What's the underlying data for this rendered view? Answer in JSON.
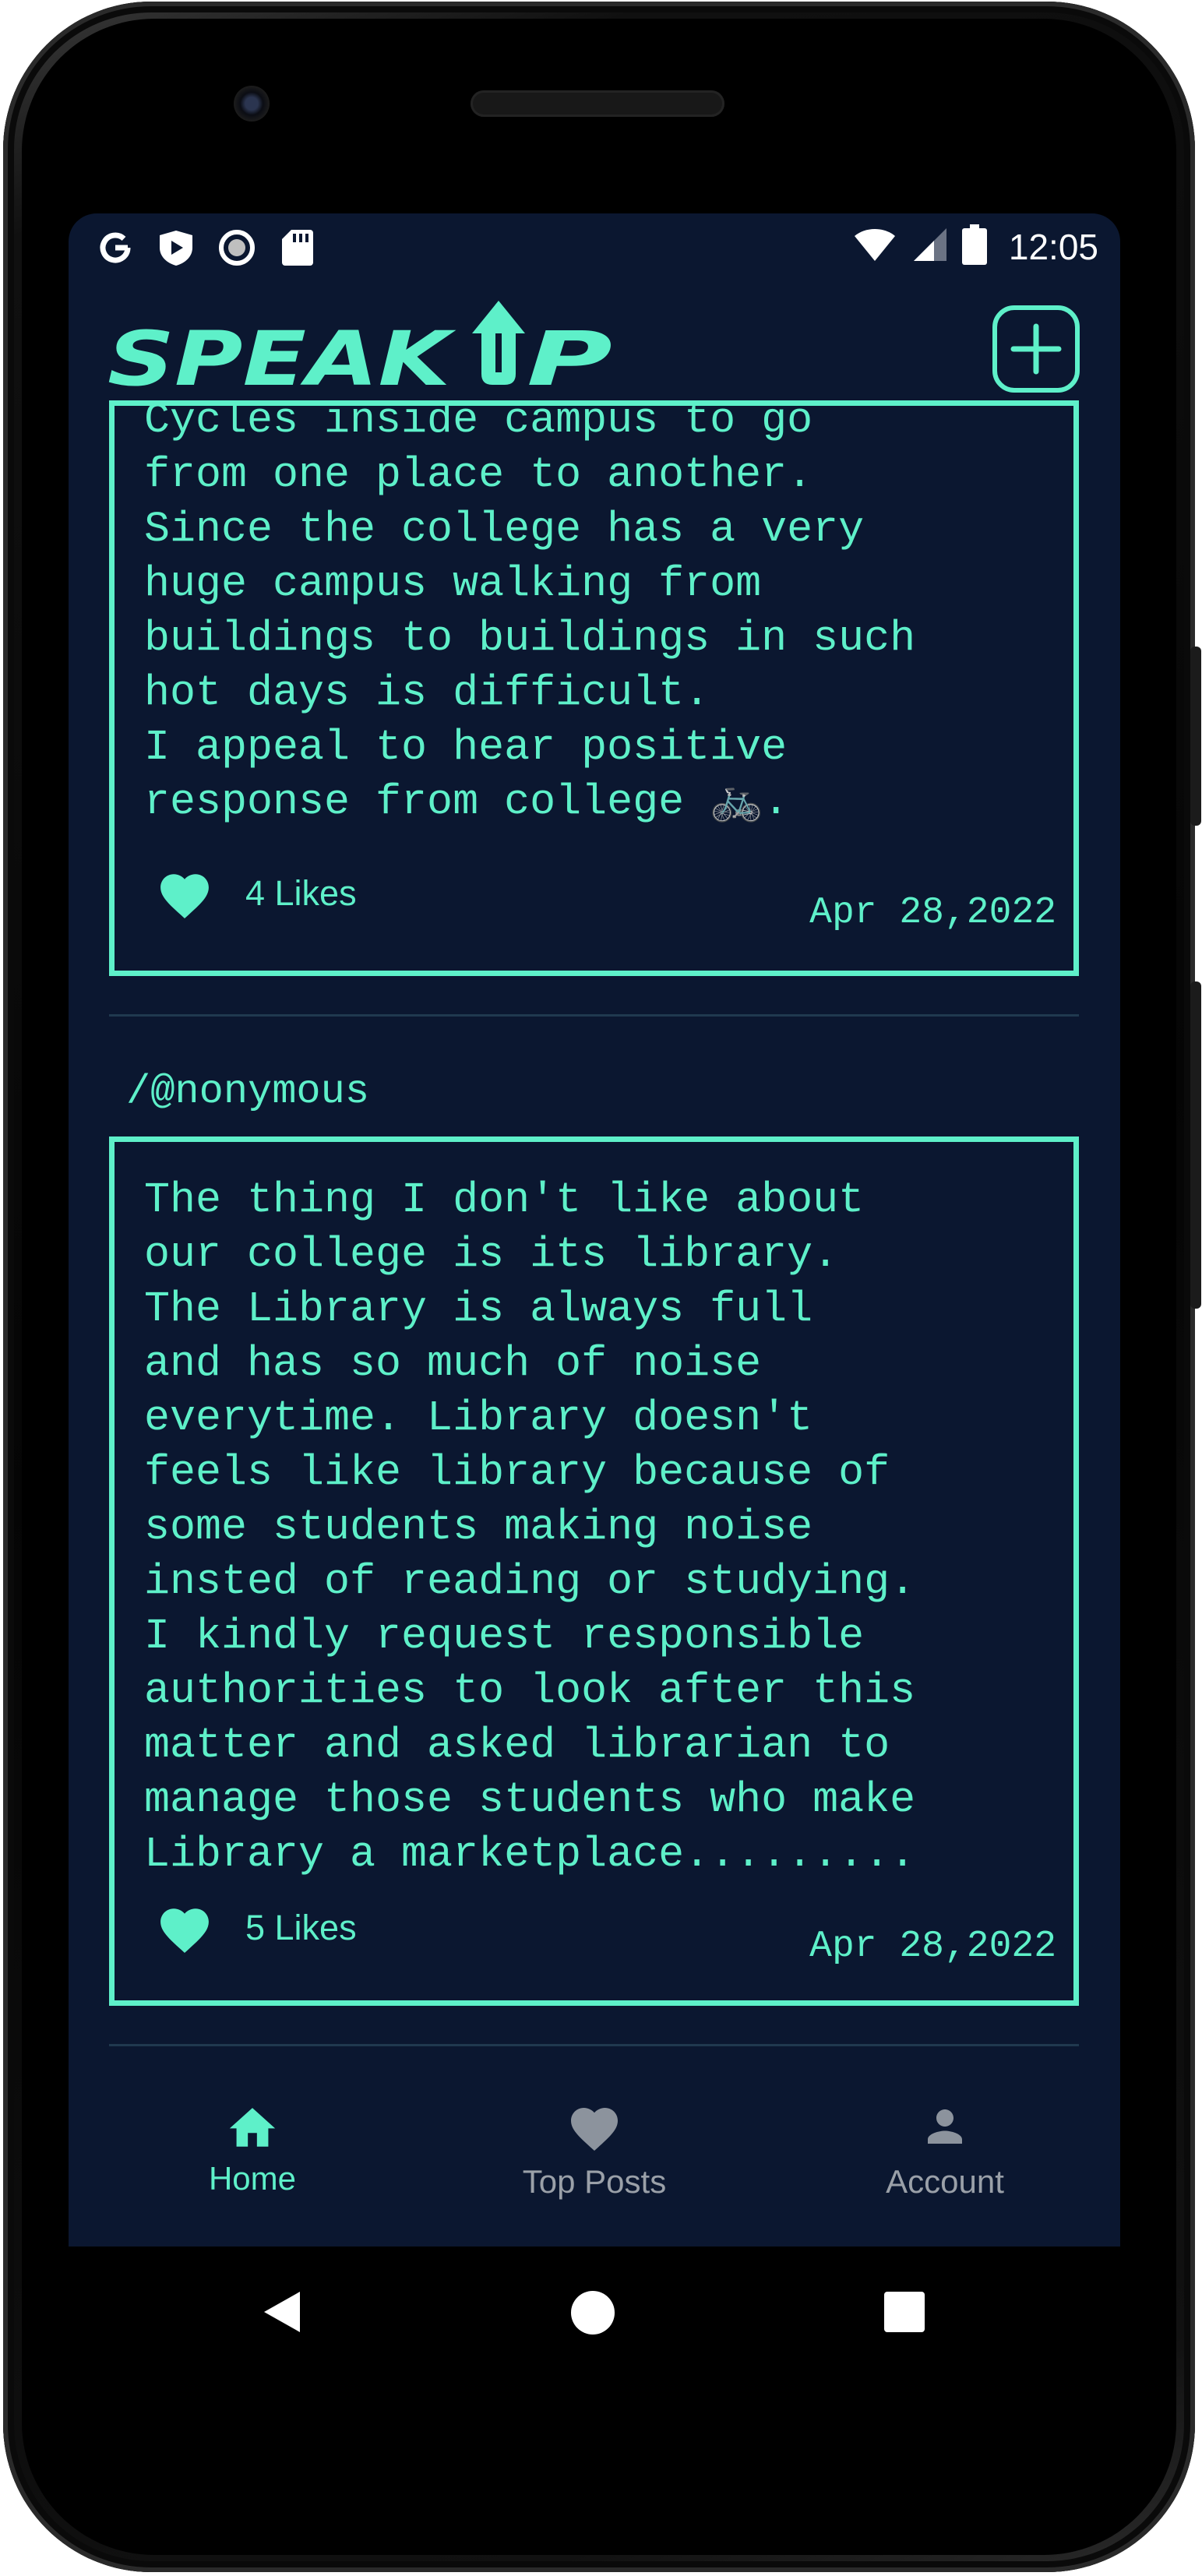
{
  "status_bar": {
    "time": "12:05",
    "left_icons": [
      "google-g-icon",
      "play-protect-icon",
      "record-icon",
      "sd-card-icon"
    ],
    "right_icons": [
      "wifi-icon",
      "signal-icon",
      "battery-icon"
    ]
  },
  "app": {
    "logo_text": "SPEAK UP",
    "add_post_icon": "plus-square-icon",
    "accent_color": "#5ef0c9",
    "background_color": "#0b1730"
  },
  "posts": [
    {
      "author": "",
      "text": "Cycles inside campus to go\nfrom one place to another.\nSince the college has a very\nhuge campus walking from\nbuildings to buildings in such\nhot days is difficult.\nI appeal to hear positive\nresponse from college 🚲.",
      "likes": "4 Likes",
      "date": "Apr 28,2022"
    },
    {
      "author": "/@nonymous",
      "text": "The thing I don't like about\nour college is its library.\nThe Library is always full\nand has so much of noise\neverytime. Library doesn't\nfeels like library because of\nsome students making noise\ninsted of reading or studying.\nI kindly request responsible\nauthorities to look after this\nmatter and asked librarian to\nmanage those students who make\nLibrary a marketplace.........",
      "likes": "5 Likes",
      "date": "Apr 28,2022"
    }
  ],
  "bottom_nav": [
    {
      "label": "Home",
      "icon": "home-icon",
      "active": true
    },
    {
      "label": "Top Posts",
      "icon": "heart-icon",
      "active": false
    },
    {
      "label": "Account",
      "icon": "person-icon",
      "active": false
    }
  ],
  "system_nav": [
    "back-icon",
    "home-circle-icon",
    "recents-icon"
  ]
}
